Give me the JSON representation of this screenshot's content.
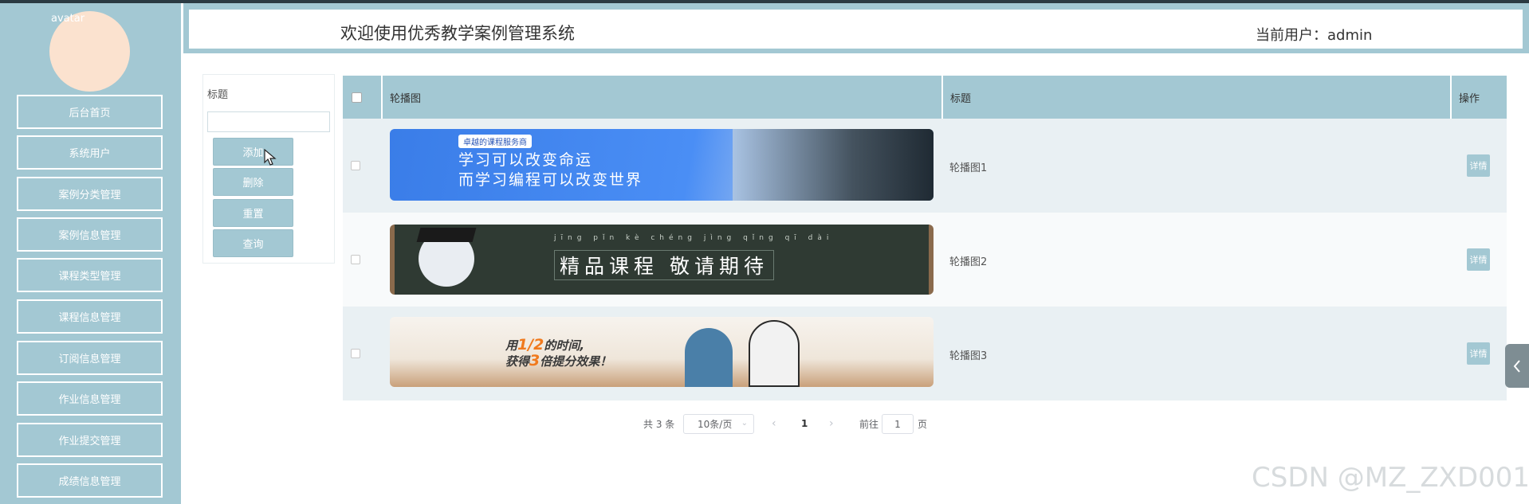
{
  "sidebar": {
    "avatar_alt": "avatar",
    "items": [
      {
        "label": "后台首页"
      },
      {
        "label": "系统用户"
      },
      {
        "label": "案例分类管理"
      },
      {
        "label": "案例信息管理"
      },
      {
        "label": "课程类型管理"
      },
      {
        "label": "课程信息管理"
      },
      {
        "label": "订阅信息管理"
      },
      {
        "label": "作业信息管理"
      },
      {
        "label": "作业提交管理"
      },
      {
        "label": "成绩信息管理"
      }
    ]
  },
  "header": {
    "title": "欢迎使用优秀教学案例管理系统",
    "user": "当前用户：admin"
  },
  "search": {
    "label": "标题",
    "value": "",
    "buttons": {
      "add": "添加",
      "delete": "删除",
      "reset": "重置",
      "query": "查询"
    }
  },
  "table": {
    "columns": {
      "banner": "轮播图",
      "title": "标题",
      "action": "操作"
    },
    "rows": [
      {
        "title": "轮播图1",
        "action": "详情",
        "banner": {
          "tag": "卓越的课程服务商",
          "line1": "学习可以改变命运",
          "line2": "而学习编程可以改变世界",
          "bg": "#3a7de8"
        }
      },
      {
        "title": "轮播图2",
        "action": "详情",
        "banner": {
          "pinyin": "jīng pǐn kè chéng  jìng qǐng qī dài",
          "text": "精品课程 敬请期待",
          "bg": "#2f3a33"
        }
      },
      {
        "title": "轮播图3",
        "action": "详情",
        "banner": {
          "line1a": "用",
          "line1b": "1/2",
          "line1c": "的时间,",
          "line2a": "获得",
          "line2b": "3",
          "line2c": "倍提分效果！",
          "bg": "#efe6da"
        }
      }
    ]
  },
  "pagination": {
    "total": "共 3 条",
    "page_size": "10条/页",
    "current": "1",
    "goto_prefix": "前往",
    "goto_value": "1",
    "goto_suffix": "页"
  },
  "side_tab": {
    "icon": "chevron-left-icon"
  },
  "watermark": "CSDN @MZ_ZXD001",
  "colors": {
    "accent": "#a3c8d3",
    "row_alt": "#e9f0f3"
  }
}
